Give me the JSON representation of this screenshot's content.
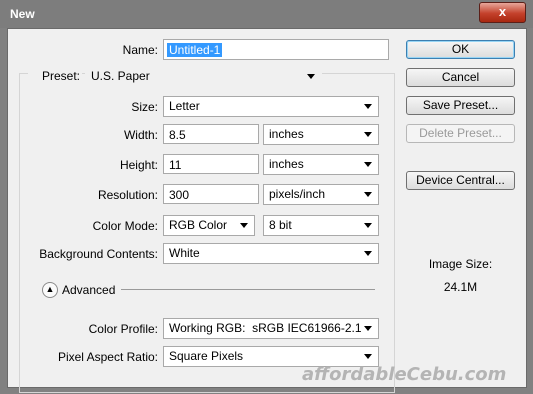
{
  "window": {
    "title": "New",
    "close_glyph": "x"
  },
  "name": {
    "label": "Name:",
    "value": "Untitled-1"
  },
  "preset": {
    "label": "Preset:",
    "value": "U.S. Paper"
  },
  "size": {
    "label": "Size:",
    "value": "Letter"
  },
  "width": {
    "label": "Width:",
    "value": "8.5",
    "unit": "inches"
  },
  "height": {
    "label": "Height:",
    "value": "11",
    "unit": "inches"
  },
  "resolution": {
    "label": "Resolution:",
    "value": "300",
    "unit": "pixels/inch"
  },
  "color_mode": {
    "label": "Color Mode:",
    "value": "RGB Color",
    "depth": "8 bit"
  },
  "background": {
    "label": "Background Contents:",
    "value": "White"
  },
  "advanced": {
    "label": "Advanced",
    "icon": "chevron-up-icon"
  },
  "color_profile": {
    "label": "Color Profile:",
    "value": "Working RGB:  sRGB IEC61966-2.1"
  },
  "pixel_aspect": {
    "label": "Pixel Aspect Ratio:",
    "value": "Square Pixels"
  },
  "buttons": {
    "ok": "OK",
    "cancel": "Cancel",
    "save_preset": "Save Preset...",
    "delete_preset": "Delete Preset...",
    "device_central": "Device Central..."
  },
  "image_size": {
    "label": "Image Size:",
    "value": "24.1M"
  },
  "watermark": "affordableCebu.com",
  "colors": {
    "selection": "#3399ff",
    "close_button": "#c4412b",
    "dialog_bg": "#f0f0f0"
  }
}
